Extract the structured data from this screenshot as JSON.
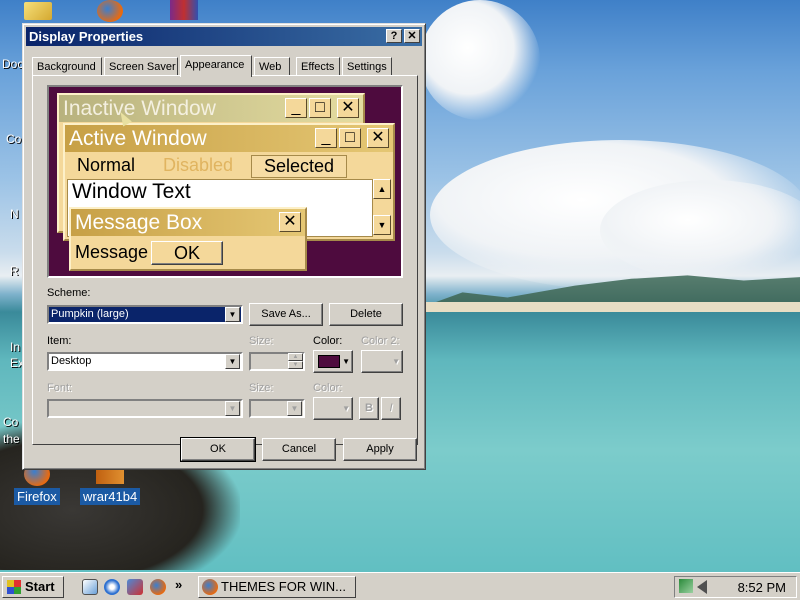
{
  "window": {
    "title": "Display Properties",
    "help_btn": "?",
    "close_btn": "✕"
  },
  "tabs": [
    {
      "label": "Background"
    },
    {
      "label": "Screen Saver"
    },
    {
      "label": "Appearance"
    },
    {
      "label": "Web"
    },
    {
      "label": "Effects"
    },
    {
      "label": "Settings"
    }
  ],
  "preview": {
    "inactive_title": "Inactive Window",
    "active_title": "Active Window",
    "menu_normal": "Normal",
    "menu_disabled": "Disabled",
    "menu_selected": "Selected",
    "window_text": "Window Text",
    "msgbox_title": "Message Box",
    "msgbox_text": "Message Text",
    "msgbox_ok": "OK",
    "min_glyph": "_",
    "max_glyph": "□",
    "close_glyph": "✕",
    "colors": {
      "desktop": "#4e0b3e",
      "window_face": "#f4d89a",
      "active_title": "#c7a046"
    }
  },
  "form": {
    "scheme_label": "Scheme:",
    "scheme_value": "Pumpkin (large)",
    "save_as": "Save As...",
    "delete": "Delete",
    "item_label": "Item:",
    "item_value": "Desktop",
    "size_label": "Size:",
    "color_label": "Color:",
    "color2_label": "Color 2:",
    "font_label": "Font:",
    "font_size_label": "Size:",
    "font_color_label": "Color:",
    "bold_btn": "B",
    "italic_btn": "I",
    "item_color": "#4e0b3e"
  },
  "buttons": {
    "ok": "OK",
    "cancel": "Cancel",
    "apply": "Apply"
  },
  "desktop": {
    "icons": [
      {
        "label": "Firefox"
      },
      {
        "label": "wrar41b4"
      }
    ],
    "partial_labels": [
      "Doc",
      "Co",
      "N",
      "R",
      "In",
      "Ex",
      "Co",
      "the"
    ]
  },
  "taskbar": {
    "start": "Start",
    "task": "THEMES FOR WIN...",
    "clock": "8:52 PM",
    "more": "»"
  }
}
